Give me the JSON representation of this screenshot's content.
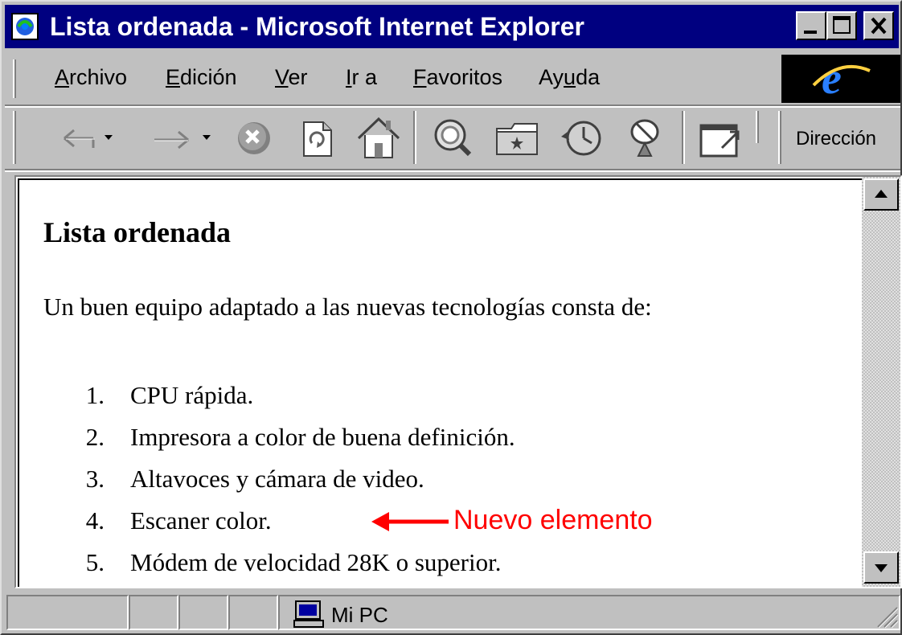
{
  "window": {
    "title": "Lista ordenada - Microsoft Internet Explorer"
  },
  "menu": {
    "items": [
      {
        "label": "Archivo",
        "icon": null
      },
      {
        "label": "Edición"
      },
      {
        "label": "Ver"
      },
      {
        "label": "Ir a"
      },
      {
        "label": "Favoritos"
      },
      {
        "label": "Ayuda"
      }
    ]
  },
  "toolbar": {
    "buttons": [
      {
        "icon": "back-arrow-icon"
      },
      {
        "icon": "forward-arrow-icon"
      },
      {
        "icon": "stop-icon"
      },
      {
        "icon": "refresh-icon"
      },
      {
        "icon": "home-icon"
      },
      {
        "icon": "search-icon"
      },
      {
        "icon": "favorites-folder-icon"
      },
      {
        "icon": "history-icon"
      },
      {
        "icon": "channels-satellite-icon"
      },
      {
        "icon": "fullscreen-icon"
      }
    ],
    "address_label": "Dirección"
  },
  "page": {
    "heading": "Lista ordenada",
    "intro": "Un buen equipo adaptado a las nuevas tecnologías consta de:",
    "list": [
      {
        "num": "1.",
        "text": "CPU rápida."
      },
      {
        "num": "2.",
        "text": "Impresora a color de buena definición."
      },
      {
        "num": "3.",
        "text": "Altavoces y cámara de video."
      },
      {
        "num": "4.",
        "text": "Escaner color."
      },
      {
        "num": "5.",
        "text": "Módem de velocidad 28K o superior."
      }
    ],
    "annotation": "Nuevo elemento",
    "annotation_color": "#ff0000"
  },
  "status": {
    "zone": "Mi PC"
  },
  "colors": {
    "titlebar": "#000080",
    "chrome": "#c0c0c0"
  }
}
